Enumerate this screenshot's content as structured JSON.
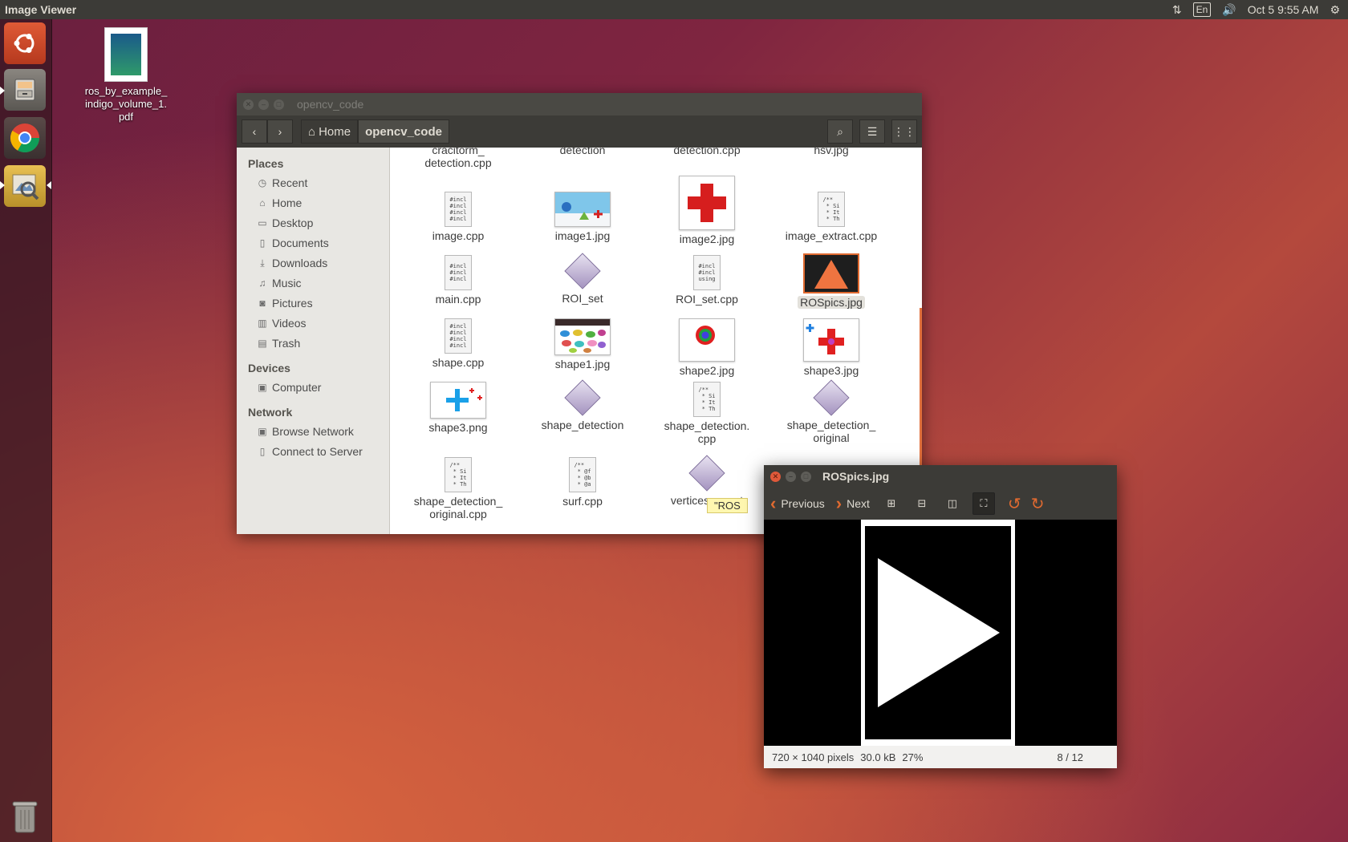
{
  "top_panel": {
    "app_name": "Image Viewer",
    "keyboard": "En",
    "clock": "Oct  5  9:55 AM"
  },
  "launcher": {
    "items": [
      "ubuntu-dash",
      "files",
      "chrome",
      "image-viewer",
      "trash"
    ]
  },
  "desktop": {
    "icon_label": "ros_by_example_\nindigo_volume_1.\npdf"
  },
  "file_manager": {
    "title": "opencv_code",
    "breadcrumb_home": "Home",
    "breadcrumb_current": "opencv_code",
    "sidebar": {
      "places_heading": "Places",
      "places": [
        "Recent",
        "Home",
        "Desktop",
        "Documents",
        "Downloads",
        "Music",
        "Pictures",
        "Videos",
        "Trash"
      ],
      "devices_heading": "Devices",
      "devices": [
        "Computer"
      ],
      "network_heading": "Network",
      "network": [
        "Browse Network",
        "Connect to Server"
      ]
    },
    "files": {
      "partial_1": "cracitorm_\ndetection.cpp",
      "partial_2": "detection",
      "partial_3": "detection.cpp",
      "partial_4": "hsv.jpg",
      "f1": "image.cpp",
      "f2": "image1.jpg",
      "f3": "image2.jpg",
      "f4": "image_extract.cpp",
      "f5": "main.cpp",
      "f6": "ROI_set",
      "f7": "ROI_set.cpp",
      "f8": "ROSpics.jpg",
      "f9": "shape.cpp",
      "f10": "shape1.jpg",
      "f11": "shape2.jpg",
      "f12": "shape3.jpg",
      "f13": "shape3.png",
      "f14": "shape_detection",
      "f15": "shape_detection.\ncpp",
      "f16": "shape_detection_\noriginal",
      "f17": "shape_detection_\noriginal.cpp",
      "f18": "surf.cpp",
      "f19": "vertices_count"
    },
    "doc_snippets": {
      "incl4": "#incl\n#incl\n#incl\n#incl",
      "incl3": "#incl\n#incl\n#incl",
      "incl_using": "#incl\n#incl\nusing",
      "doc_si": "/**\n * Si\n * It\n * Th",
      "doc_f": "/**\n * @f\n * @b\n * @a"
    },
    "tooltip": "\"ROS"
  },
  "image_viewer": {
    "title": "ROSpics.jpg",
    "previous_label": "Previous",
    "next_label": "Next",
    "status": {
      "dimensions": "720 × 1040 pixels",
      "size": "30.0 kB",
      "zoom": "27%",
      "counter": "8 / 12"
    }
  },
  "colors": {
    "accent_orange": "#e06a30",
    "panel_dark": "#3c3b37",
    "close_button": "#e0593a"
  }
}
